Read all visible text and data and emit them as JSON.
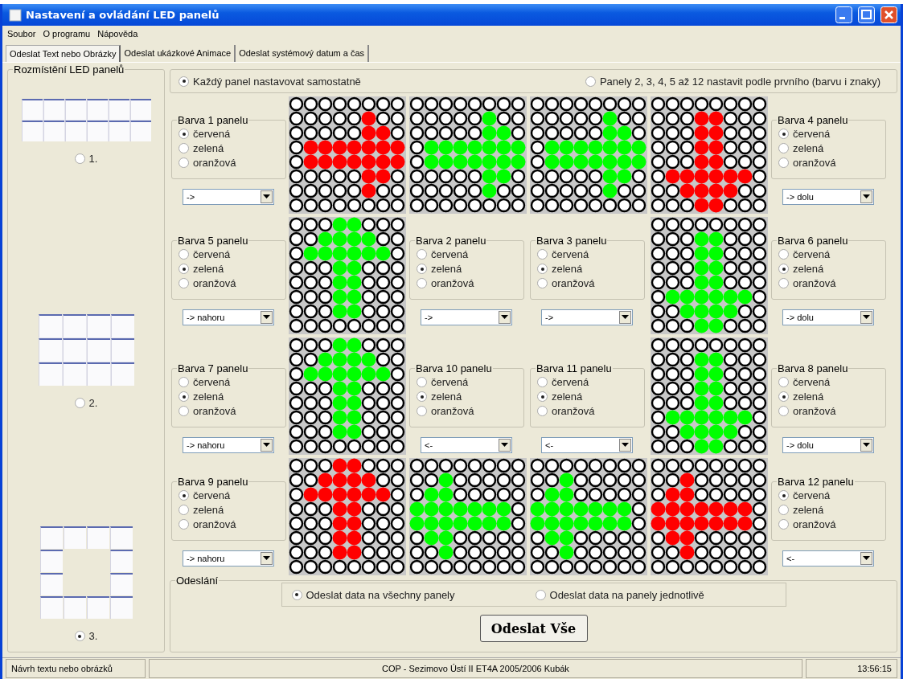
{
  "window": {
    "title": "Nastavení a ovládání LED panelů"
  },
  "menu": [
    "Soubor",
    "O programu",
    "Nápověda"
  ],
  "tabs": [
    {
      "label": "Odeslat Text nebo Obrázky",
      "selected": true
    },
    {
      "label": "Odeslat ukázkové Animace",
      "selected": false
    },
    {
      "label": "Odeslat systémový datum a čas",
      "selected": false
    }
  ],
  "layout_group": {
    "title": "Rozmístění LED panelů",
    "options": [
      {
        "label": "1.",
        "kind": "strip",
        "selected": false
      },
      {
        "label": "2.",
        "kind": "block",
        "selected": false
      },
      {
        "label": "3.",
        "kind": "ring",
        "selected": true
      }
    ]
  },
  "mode_options": [
    {
      "label": "Každý panel nastavovat samostatně",
      "selected": true
    },
    {
      "label": "Panely 2, 3, 4, 5 až 12 nastavit podle prvního (barvu i znaky)",
      "selected": false
    }
  ],
  "grid_rows": [
    [
      {
        "kind": "control",
        "title": "Barva 1 panelu",
        "options": [
          {
            "label": "červená",
            "selected": true
          },
          {
            "label": "zelená",
            "selected": false
          },
          {
            "label": "oranžová",
            "selected": false
          }
        ],
        "direction": "->"
      },
      {
        "kind": "leds",
        "color": "#ff0000",
        "lit": [
          [
            false,
            false,
            false,
            false,
            false,
            false,
            false,
            false
          ],
          [
            false,
            false,
            false,
            false,
            false,
            true,
            false,
            false
          ],
          [
            false,
            false,
            false,
            false,
            false,
            true,
            true,
            false
          ],
          [
            false,
            true,
            true,
            true,
            true,
            true,
            true,
            true
          ],
          [
            false,
            true,
            true,
            true,
            true,
            true,
            true,
            true
          ],
          [
            false,
            false,
            false,
            false,
            false,
            true,
            true,
            false
          ],
          [
            false,
            false,
            false,
            false,
            false,
            true,
            false,
            false
          ],
          [
            false,
            false,
            false,
            false,
            false,
            false,
            false,
            false
          ]
        ]
      },
      {
        "kind": "leds",
        "color": "#00ff00",
        "lit": [
          [
            false,
            false,
            false,
            false,
            false,
            false,
            false,
            false
          ],
          [
            false,
            false,
            false,
            false,
            false,
            true,
            false,
            false
          ],
          [
            false,
            false,
            false,
            false,
            false,
            true,
            true,
            false
          ],
          [
            false,
            true,
            true,
            true,
            true,
            true,
            true,
            true
          ],
          [
            false,
            true,
            true,
            true,
            true,
            true,
            true,
            true
          ],
          [
            false,
            false,
            false,
            false,
            false,
            true,
            true,
            false
          ],
          [
            false,
            false,
            false,
            false,
            false,
            true,
            false,
            false
          ],
          [
            false,
            false,
            false,
            false,
            false,
            false,
            false,
            false
          ]
        ]
      },
      {
        "kind": "leds",
        "color": "#00ff00",
        "lit": [
          [
            false,
            false,
            false,
            false,
            false,
            false,
            false,
            false
          ],
          [
            false,
            false,
            false,
            false,
            false,
            true,
            false,
            false
          ],
          [
            false,
            false,
            false,
            false,
            false,
            true,
            true,
            false
          ],
          [
            false,
            true,
            true,
            true,
            true,
            true,
            true,
            true
          ],
          [
            false,
            true,
            true,
            true,
            true,
            true,
            true,
            true
          ],
          [
            false,
            false,
            false,
            false,
            false,
            true,
            true,
            false
          ],
          [
            false,
            false,
            false,
            false,
            false,
            true,
            false,
            false
          ],
          [
            false,
            false,
            false,
            false,
            false,
            false,
            false,
            false
          ]
        ]
      },
      {
        "kind": "leds",
        "color": "#ff0000",
        "lit": [
          [
            false,
            false,
            false,
            false,
            false,
            false,
            false,
            false
          ],
          [
            false,
            false,
            false,
            true,
            true,
            false,
            false,
            false
          ],
          [
            false,
            false,
            false,
            true,
            true,
            false,
            false,
            false
          ],
          [
            false,
            false,
            false,
            true,
            true,
            false,
            false,
            false
          ],
          [
            false,
            false,
            false,
            true,
            true,
            false,
            false,
            false
          ],
          [
            false,
            true,
            true,
            true,
            true,
            true,
            true,
            false
          ],
          [
            false,
            false,
            true,
            true,
            true,
            true,
            false,
            false
          ],
          [
            false,
            false,
            false,
            true,
            true,
            false,
            false,
            false
          ]
        ]
      },
      {
        "kind": "control",
        "title": "Barva 4 panelu",
        "options": [
          {
            "label": "červená",
            "selected": true
          },
          {
            "label": "zelená",
            "selected": false
          },
          {
            "label": "oranžová",
            "selected": false
          }
        ],
        "direction": "-> dolu"
      }
    ],
    [
      {
        "kind": "control",
        "title": "Barva 5 panelu",
        "options": [
          {
            "label": "červená",
            "selected": false
          },
          {
            "label": "zelená",
            "selected": true
          },
          {
            "label": "oranžová",
            "selected": false
          }
        ],
        "direction": "-> nahoru"
      },
      {
        "kind": "leds",
        "color": "#00ff00",
        "lit": [
          [
            false,
            false,
            false,
            true,
            true,
            false,
            false,
            false
          ],
          [
            false,
            false,
            true,
            true,
            true,
            true,
            false,
            false
          ],
          [
            false,
            true,
            true,
            true,
            true,
            true,
            true,
            false
          ],
          [
            false,
            false,
            false,
            true,
            true,
            false,
            false,
            false
          ],
          [
            false,
            false,
            false,
            true,
            true,
            false,
            false,
            false
          ],
          [
            false,
            false,
            false,
            true,
            true,
            false,
            false,
            false
          ],
          [
            false,
            false,
            false,
            true,
            true,
            false,
            false,
            false
          ],
          [
            false,
            false,
            false,
            false,
            false,
            false,
            false,
            false
          ]
        ]
      },
      {
        "kind": "control",
        "title": "Barva 2 panelu",
        "options": [
          {
            "label": "červená",
            "selected": false
          },
          {
            "label": "zelená",
            "selected": true
          },
          {
            "label": "oranžová",
            "selected": false
          }
        ],
        "direction": "->"
      },
      {
        "kind": "control",
        "title": "Barva 3 panelu",
        "options": [
          {
            "label": "červená",
            "selected": false
          },
          {
            "label": "zelená",
            "selected": true
          },
          {
            "label": "oranžová",
            "selected": false
          }
        ],
        "direction": "->"
      },
      {
        "kind": "leds",
        "color": "#00ff00",
        "lit": [
          [
            false,
            false,
            false,
            false,
            false,
            false,
            false,
            false
          ],
          [
            false,
            false,
            false,
            true,
            true,
            false,
            false,
            false
          ],
          [
            false,
            false,
            false,
            true,
            true,
            false,
            false,
            false
          ],
          [
            false,
            false,
            false,
            true,
            true,
            false,
            false,
            false
          ],
          [
            false,
            false,
            false,
            true,
            true,
            false,
            false,
            false
          ],
          [
            false,
            true,
            true,
            true,
            true,
            true,
            true,
            false
          ],
          [
            false,
            false,
            true,
            true,
            true,
            true,
            false,
            false
          ],
          [
            false,
            false,
            false,
            true,
            true,
            false,
            false,
            false
          ]
        ]
      },
      {
        "kind": "control",
        "title": "Barva 6 panelu",
        "options": [
          {
            "label": "červená",
            "selected": false
          },
          {
            "label": "zelená",
            "selected": true
          },
          {
            "label": "oranžová",
            "selected": false
          }
        ],
        "direction": "-> dolu"
      }
    ],
    [
      {
        "kind": "control",
        "title": "Barva 7 panelu",
        "options": [
          {
            "label": "červená",
            "selected": false
          },
          {
            "label": "zelená",
            "selected": true
          },
          {
            "label": "oranžová",
            "selected": false
          }
        ],
        "direction": "-> nahoru"
      },
      {
        "kind": "leds",
        "color": "#00ff00",
        "lit": [
          [
            false,
            false,
            false,
            true,
            true,
            false,
            false,
            false
          ],
          [
            false,
            false,
            true,
            true,
            true,
            true,
            false,
            false
          ],
          [
            false,
            true,
            true,
            true,
            true,
            true,
            true,
            false
          ],
          [
            false,
            false,
            false,
            true,
            true,
            false,
            false,
            false
          ],
          [
            false,
            false,
            false,
            true,
            true,
            false,
            false,
            false
          ],
          [
            false,
            false,
            false,
            true,
            true,
            false,
            false,
            false
          ],
          [
            false,
            false,
            false,
            true,
            true,
            false,
            false,
            false
          ],
          [
            false,
            false,
            false,
            false,
            false,
            false,
            false,
            false
          ]
        ]
      },
      {
        "kind": "control",
        "title": "Barva 10 panelu",
        "options": [
          {
            "label": "červená",
            "selected": false
          },
          {
            "label": "zelená",
            "selected": true
          },
          {
            "label": "oranžová",
            "selected": false
          }
        ],
        "direction": "<-"
      },
      {
        "kind": "control",
        "title": "Barva 11 panelu",
        "options": [
          {
            "label": "červená",
            "selected": false
          },
          {
            "label": "zelená",
            "selected": true
          },
          {
            "label": "oranžová",
            "selected": false
          }
        ],
        "direction": "<-"
      },
      {
        "kind": "leds",
        "color": "#00ff00",
        "lit": [
          [
            false,
            false,
            false,
            false,
            false,
            false,
            false,
            false
          ],
          [
            false,
            false,
            false,
            true,
            true,
            false,
            false,
            false
          ],
          [
            false,
            false,
            false,
            true,
            true,
            false,
            false,
            false
          ],
          [
            false,
            false,
            false,
            true,
            true,
            false,
            false,
            false
          ],
          [
            false,
            false,
            false,
            true,
            true,
            false,
            false,
            false
          ],
          [
            false,
            true,
            true,
            true,
            true,
            true,
            true,
            false
          ],
          [
            false,
            false,
            true,
            true,
            true,
            true,
            false,
            false
          ],
          [
            false,
            false,
            false,
            true,
            true,
            false,
            false,
            false
          ]
        ]
      },
      {
        "kind": "control",
        "title": "Barva 8 panelu",
        "options": [
          {
            "label": "červená",
            "selected": false
          },
          {
            "label": "zelená",
            "selected": true
          },
          {
            "label": "oranžová",
            "selected": false
          }
        ],
        "direction": "-> dolu"
      }
    ],
    [
      {
        "kind": "control",
        "title": "Barva 9 panelu",
        "options": [
          {
            "label": "červená",
            "selected": true
          },
          {
            "label": "zelená",
            "selected": false
          },
          {
            "label": "oranžová",
            "selected": false
          }
        ],
        "direction": "-> nahoru"
      },
      {
        "kind": "leds",
        "color": "#ff0000",
        "lit": [
          [
            false,
            false,
            false,
            true,
            true,
            false,
            false,
            false
          ],
          [
            false,
            false,
            true,
            true,
            true,
            true,
            false,
            false
          ],
          [
            false,
            true,
            true,
            true,
            true,
            true,
            true,
            false
          ],
          [
            false,
            false,
            false,
            true,
            true,
            false,
            false,
            false
          ],
          [
            false,
            false,
            false,
            true,
            true,
            false,
            false,
            false
          ],
          [
            false,
            false,
            false,
            true,
            true,
            false,
            false,
            false
          ],
          [
            false,
            false,
            false,
            true,
            true,
            false,
            false,
            false
          ],
          [
            false,
            false,
            false,
            false,
            false,
            false,
            false,
            false
          ]
        ]
      },
      {
        "kind": "leds",
        "color": "#00ff00",
        "lit": [
          [
            false,
            false,
            false,
            false,
            false,
            false,
            false,
            false
          ],
          [
            false,
            false,
            true,
            false,
            false,
            false,
            false,
            false
          ],
          [
            false,
            true,
            true,
            false,
            false,
            false,
            false,
            false
          ],
          [
            true,
            true,
            true,
            true,
            true,
            true,
            true,
            false
          ],
          [
            true,
            true,
            true,
            true,
            true,
            true,
            true,
            false
          ],
          [
            false,
            true,
            true,
            false,
            false,
            false,
            false,
            false
          ],
          [
            false,
            false,
            true,
            false,
            false,
            false,
            false,
            false
          ],
          [
            false,
            false,
            false,
            false,
            false,
            false,
            false,
            false
          ]
        ]
      },
      {
        "kind": "leds",
        "color": "#00ff00",
        "lit": [
          [
            false,
            false,
            false,
            false,
            false,
            false,
            false,
            false
          ],
          [
            false,
            false,
            true,
            false,
            false,
            false,
            false,
            false
          ],
          [
            false,
            true,
            true,
            false,
            false,
            false,
            false,
            false
          ],
          [
            true,
            true,
            true,
            true,
            true,
            true,
            true,
            false
          ],
          [
            true,
            true,
            true,
            true,
            true,
            true,
            true,
            false
          ],
          [
            false,
            true,
            true,
            false,
            false,
            false,
            false,
            false
          ],
          [
            false,
            false,
            true,
            false,
            false,
            false,
            false,
            false
          ],
          [
            false,
            false,
            false,
            false,
            false,
            false,
            false,
            false
          ]
        ]
      },
      {
        "kind": "leds",
        "color": "#ff0000",
        "lit": [
          [
            false,
            false,
            false,
            false,
            false,
            false,
            false,
            false
          ],
          [
            false,
            false,
            true,
            false,
            false,
            false,
            false,
            false
          ],
          [
            false,
            true,
            true,
            false,
            false,
            false,
            false,
            false
          ],
          [
            true,
            true,
            true,
            true,
            true,
            true,
            true,
            false
          ],
          [
            true,
            true,
            true,
            true,
            true,
            true,
            true,
            false
          ],
          [
            false,
            true,
            true,
            false,
            false,
            false,
            false,
            false
          ],
          [
            false,
            false,
            true,
            false,
            false,
            false,
            false,
            false
          ],
          [
            false,
            false,
            false,
            false,
            false,
            false,
            false,
            false
          ]
        ]
      },
      {
        "kind": "control",
        "title": "Barva 12 panelu",
        "options": [
          {
            "label": "červená",
            "selected": true
          },
          {
            "label": "zelená",
            "selected": false
          },
          {
            "label": "oranžová",
            "selected": false
          }
        ],
        "direction": "<-"
      }
    ]
  ],
  "send_group": {
    "title": "Odeslání",
    "options": [
      {
        "label": "Odeslat data na všechny panely",
        "selected": true
      },
      {
        "label": "Odeslat data na panely jednotlivě",
        "selected": false
      }
    ],
    "button": "Odeslat Vše"
  },
  "status_bar": [
    "Návrh textu nebo obrázků",
    "COP - Sezimovo Ústí II  ET4A 2005/2006 Kubák",
    "13:56:15"
  ]
}
